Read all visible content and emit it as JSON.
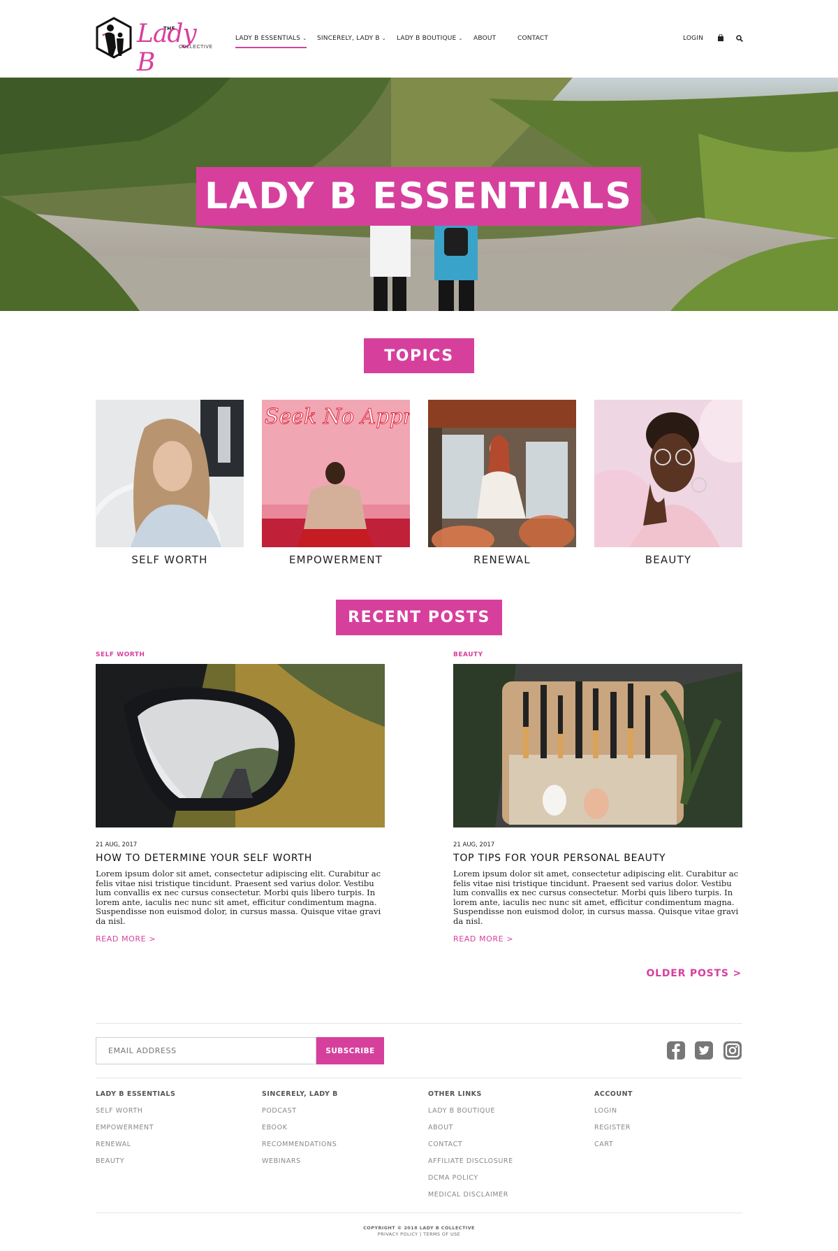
{
  "header": {
    "logo": {
      "the": "THE",
      "script": "Lady B",
      "collective": "COLLECTIVE"
    },
    "nav": [
      {
        "label": "LADY B ESSENTIALS",
        "dropdown": true,
        "active": true
      },
      {
        "label": "SINCERELY, LADY B",
        "dropdown": true
      },
      {
        "label": "LADY B BOUTIQUE",
        "dropdown": true
      },
      {
        "label": "ABOUT"
      },
      {
        "label": "CONTACT"
      }
    ],
    "login_label": "LOGIN",
    "chevron_glyph": "⌄",
    "icons": {
      "cart": "shopping-bag-icon",
      "search": "search-icon"
    }
  },
  "hero": {
    "title": "LADY B ESSENTIALS"
  },
  "topics": {
    "heading": "TOPICS",
    "items": [
      {
        "label": "SELF WORTH"
      },
      {
        "label": "EMPOWERMENT"
      },
      {
        "label": "RENEWAL"
      },
      {
        "label": "BEAUTY"
      }
    ]
  },
  "neon_sign": "Seek No Approval",
  "recent_posts": {
    "heading": "RECENT POSTS",
    "posts": [
      {
        "category": "SELF WORTH",
        "date": "21 AUG, 2017",
        "title": "HOW TO DETERMINE YOUR SELF WORTH",
        "excerpt": "Lorem ipsum dolor sit amet, consectetur adipiscing elit. Curabitur ac felis vitae nisi tristique tincidunt. Praesent sed varius dolor. Vestibu lum convallis ex nec cursus consectetur. Morbi quis libero turpis. In lorem ante, iaculis nec nunc sit amet, efficitur condimentum magna. Suspendisse non euismod dolor, in cursus massa. Quisque vitae gravi da nisl.",
        "read_more": "READ MORE >"
      },
      {
        "category": "BEAUTY",
        "date": "21 AUG, 2017",
        "title": "TOP TIPS FOR YOUR PERSONAL BEAUTY",
        "excerpt": "Lorem ipsum dolor sit amet, consectetur adipiscing elit. Curabitur ac felis vitae nisi tristique tincidunt. Praesent sed varius dolor. Vestibu lum convallis ex nec cursus consectetur. Morbi quis libero turpis. In lorem ante, iaculis nec nunc sit amet, efficitur condimentum magna. Suspendisse non euismod dolor, in cursus massa. Quisque vitae gravi da nisl.",
        "read_more": "READ MORE >"
      }
    ],
    "older_posts": "OLDER POSTS >"
  },
  "footer": {
    "email_placeholder": "EMAIL ADDRESS",
    "subscribe_label": "SUBSCRIBE",
    "social": [
      "facebook-icon",
      "twitter-icon",
      "instagram-icon"
    ],
    "columns": [
      {
        "heading": "LADY B ESSENTIALS",
        "links": [
          "SELF WORTH",
          "EMPOWERMENT",
          "RENEWAL",
          "BEAUTY"
        ]
      },
      {
        "heading": "SINCERELY, LADY B",
        "links": [
          "PODCAST",
          "EBOOK",
          "RECOMMENDATIONS",
          "WEBINARS"
        ]
      },
      {
        "heading": "OTHER LINKS",
        "links": [
          "LADY B BOUTIQUE",
          "ABOUT",
          "CONTACT",
          "AFFILIATE DISCLOSURE",
          "DCMA POLICY",
          "MEDICAL DISCLAIMER"
        ]
      },
      {
        "heading": "ACCOUNT",
        "links": [
          "LOGIN",
          "REGISTER",
          "CART"
        ]
      }
    ],
    "copyright": "COPYRIGHT © 2018 LADY B COLLECTIVE",
    "legal_links": [
      "PRIVACY POLICY",
      "TERMS OF USE"
    ],
    "legal_separator": "|"
  },
  "colors": {
    "accent": "#d6409c",
    "text": "#222222",
    "muted": "#888888"
  }
}
